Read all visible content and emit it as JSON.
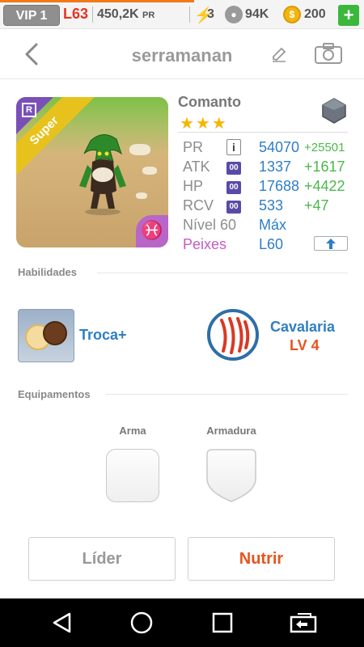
{
  "status_bar": {
    "vip": "VIP 1",
    "level": "L63",
    "pr": "450,2K",
    "pr_unit": "PR",
    "energy": "3",
    "paws": "94K",
    "coins": "200",
    "add_label": "+"
  },
  "header": {
    "title": "serramanan",
    "icons": [
      "chevron-left-icon",
      "pencil-icon",
      "camera-icon"
    ]
  },
  "monster": {
    "name": "Comanto",
    "stars": "★★★",
    "rarity_letter": "R",
    "ribbon": "Super",
    "element_symbol": "♓",
    "element_icon": "rock-element-icon",
    "stats": {
      "pr": {
        "label": "PR",
        "value": "54070",
        "bonus": "+25501"
      },
      "atk": {
        "label": "ATK",
        "badge": "00",
        "value": "1337",
        "bonus": "+1617"
      },
      "hp": {
        "label": "HP",
        "badge": "00",
        "value": "17688",
        "bonus": "+4422"
      },
      "rcv": {
        "label": "RCV",
        "badge": "00",
        "value": "533",
        "bonus": "+47"
      },
      "level": {
        "label": "Nível 60",
        "value": "Máx"
      },
      "sign": {
        "label": "Peixes",
        "value": "L60"
      }
    }
  },
  "skills": {
    "title": "Habilidades",
    "active": {
      "label": "Troca+"
    },
    "leader": {
      "label": "Cavalaria",
      "level": "LV 4"
    }
  },
  "equipment": {
    "title": "Equipamentos",
    "weapon": "Arma",
    "armor": "Armadura"
  },
  "actions": {
    "leader": "Líder",
    "feed": "Nutrir"
  },
  "colors": {
    "accent_blue": "#2f7ec4",
    "bonus_green": "#4bb84b",
    "orange": "#e8531e",
    "level_red": "#e8321e",
    "pisces_purple": "#c55bc5"
  }
}
